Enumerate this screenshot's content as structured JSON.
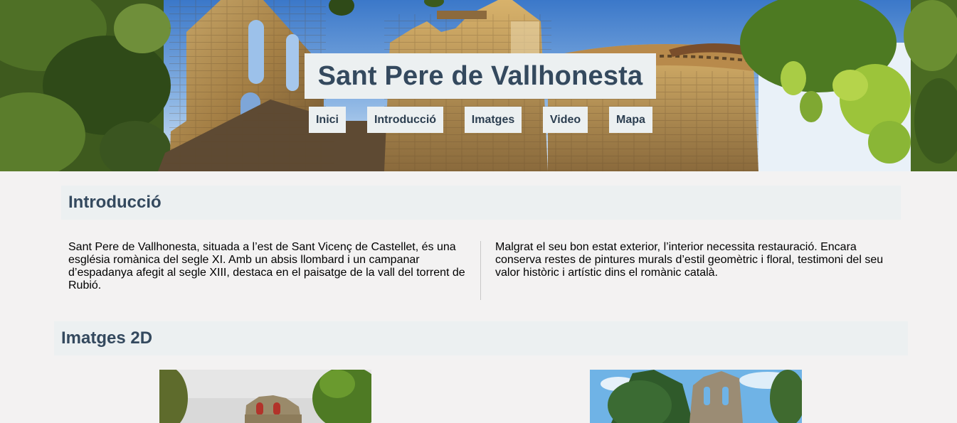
{
  "site": {
    "title": "Sant Pere de Vallhonesta"
  },
  "nav": {
    "items": [
      {
        "label": "Inici"
      },
      {
        "label": "Introducció"
      },
      {
        "label": "Imatges"
      },
      {
        "label": "Video"
      },
      {
        "label": "Mapa"
      }
    ]
  },
  "intro": {
    "heading": "Introducció",
    "col1": "Sant Pere de Vallhonesta, situada a l’est de Sant Vicenç de Castellet, és una església romànica del segle XI. Amb un absis llombard i un campanar d’espadanya afegit al segle XIII, destaca en el paisatge de la vall del torrent de Rubió.",
    "col2": "Malgrat el seu bon estat exterior, l’interior necessita restauració. Encara conserva restes de pintures murals d’estil geomètric i floral, testimoni del seu valor històric i artístic dins el romànic català."
  },
  "images": {
    "heading": "Imatges 2D"
  },
  "colors": {
    "heading_text": "#34495e",
    "heading_bg": "#ecf0f1",
    "page_bg": "#f3f2f2"
  }
}
